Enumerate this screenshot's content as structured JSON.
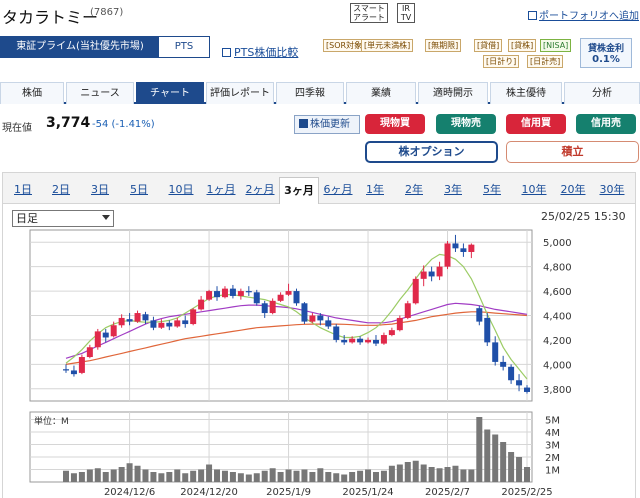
{
  "header": {
    "company": "タカラトミー",
    "code": "(7867)",
    "smart_alert": [
      "スマート",
      "アラート"
    ],
    "irtv": [
      "IR",
      "TV"
    ],
    "portfolio_link": "ポートフォリオへ追加"
  },
  "market_tabs": [
    "東証プライム(当社優先市場)",
    "PTS"
  ],
  "pts_compare": "PTS株価比較",
  "badges": [
    "[SOR対象]",
    "[単元未満株]",
    "[無期限]",
    "[貸借]",
    "[貸株]",
    "[NISA]",
    "[日計り]",
    "[日計売]"
  ],
  "margin_rate": {
    "title": "貸株金利",
    "value": "0.1%"
  },
  "main_tabs": [
    "株価",
    "ニュース",
    "チャート",
    "評価レポート",
    "四季報",
    "業績",
    "適時開示",
    "株主優待",
    "分析"
  ],
  "price": {
    "label": "現在値",
    "value": "3,774",
    "change": "-54 (-1.41%)"
  },
  "refresh": "株価更新",
  "trade_buttons": [
    "現物買",
    "現物売",
    "信用買",
    "信用売"
  ],
  "option_button": "株オプション",
  "tsumitate_button": "積立",
  "periods": [
    "1日",
    "2日",
    "3日",
    "5日",
    "10日",
    "1ヶ月",
    "2ヶ月",
    "3ヶ月",
    "6ヶ月",
    "1年",
    "2年",
    "3年",
    "5年",
    "10年",
    "20年",
    "30年"
  ],
  "active_period": "3ヶ月",
  "chart_select": "日足",
  "datetime": "25/02/25 15:30",
  "volume_unit": "単位：M",
  "colors": {
    "up": "#e0294a",
    "down": "#1f4fa8",
    "ma_short": "#9ccc65",
    "ma_mid": "#a13cc4",
    "ma_long": "#e0663a",
    "brand": "#1e4a8c"
  },
  "chart_data": {
    "type": "candlestick",
    "ylim": [
      3700,
      5100
    ],
    "yticks": [
      "5,000",
      "4,800",
      "4,600",
      "4,400",
      "4,200",
      "4,000",
      "3,800"
    ],
    "ytick_values": [
      5000,
      4800,
      4600,
      4400,
      4200,
      4000,
      3800
    ],
    "xticks": [
      "2024/12/6",
      "2024/12/20",
      "2025/1/9",
      "2025/1/24",
      "2025/2/7",
      "2025/2/25"
    ],
    "volume_ylim": [
      0,
      5.6
    ],
    "volume_yticks": [
      "5M",
      "4M",
      "3M",
      "2M",
      "1M"
    ],
    "volume_ytick_values": [
      5,
      4,
      3,
      2,
      1
    ],
    "candles": [
      {
        "date": "2024/11/26",
        "o": 3960,
        "h": 4000,
        "l": 3930,
        "c": 3950
      },
      {
        "date": "2024/11/27",
        "o": 3950,
        "h": 3990,
        "l": 3900,
        "c": 3920
      },
      {
        "date": "2024/11/28",
        "o": 3930,
        "h": 4080,
        "l": 3920,
        "c": 4060
      },
      {
        "date": "2024/11/29",
        "o": 4060,
        "h": 4160,
        "l": 4050,
        "c": 4140
      },
      {
        "date": "2024/12/2",
        "o": 4140,
        "h": 4290,
        "l": 4120,
        "c": 4270
      },
      {
        "date": "2024/12/3",
        "o": 4260,
        "h": 4290,
        "l": 4180,
        "c": 4220
      },
      {
        "date": "2024/12/4",
        "o": 4230,
        "h": 4350,
        "l": 4220,
        "c": 4320
      },
      {
        "date": "2024/12/5",
        "o": 4320,
        "h": 4410,
        "l": 4300,
        "c": 4380
      },
      {
        "date": "2024/12/6",
        "o": 4370,
        "h": 4420,
        "l": 4320,
        "c": 4350
      },
      {
        "date": "2024/12/9",
        "o": 4350,
        "h": 4440,
        "l": 4340,
        "c": 4420
      },
      {
        "date": "2024/12/10",
        "o": 4410,
        "h": 4430,
        "l": 4330,
        "c": 4360
      },
      {
        "date": "2024/12/11",
        "o": 4360,
        "h": 4390,
        "l": 4280,
        "c": 4300
      },
      {
        "date": "2024/12/12",
        "o": 4300,
        "h": 4370,
        "l": 4290,
        "c": 4340
      },
      {
        "date": "2024/12/13",
        "o": 4340,
        "h": 4360,
        "l": 4280,
        "c": 4310
      },
      {
        "date": "2024/12/16",
        "o": 4310,
        "h": 4380,
        "l": 4300,
        "c": 4360
      },
      {
        "date": "2024/12/17",
        "o": 4360,
        "h": 4400,
        "l": 4300,
        "c": 4330
      },
      {
        "date": "2024/12/18",
        "o": 4330,
        "h": 4460,
        "l": 4320,
        "c": 4450
      },
      {
        "date": "2024/12/19",
        "o": 4450,
        "h": 4560,
        "l": 4440,
        "c": 4530
      },
      {
        "date": "2024/12/20",
        "o": 4530,
        "h": 4610,
        "l": 4520,
        "c": 4600
      },
      {
        "date": "2024/12/23",
        "o": 4600,
        "h": 4640,
        "l": 4520,
        "c": 4550
      },
      {
        "date": "2024/12/24",
        "o": 4550,
        "h": 4640,
        "l": 4540,
        "c": 4620
      },
      {
        "date": "2024/12/25",
        "o": 4620,
        "h": 4650,
        "l": 4540,
        "c": 4560
      },
      {
        "date": "2024/12/26",
        "o": 4560,
        "h": 4620,
        "l": 4530,
        "c": 4600
      },
      {
        "date": "2024/12/27",
        "o": 4600,
        "h": 4640,
        "l": 4560,
        "c": 4590
      },
      {
        "date": "2024/12/30",
        "o": 4590,
        "h": 4610,
        "l": 4480,
        "c": 4500
      },
      {
        "date": "2025/1/6",
        "o": 4500,
        "h": 4520,
        "l": 4380,
        "c": 4420
      },
      {
        "date": "2025/1/7",
        "o": 4420,
        "h": 4540,
        "l": 4410,
        "c": 4520
      },
      {
        "date": "2025/1/8",
        "o": 4520,
        "h": 4590,
        "l": 4510,
        "c": 4570
      },
      {
        "date": "2025/1/9",
        "o": 4570,
        "h": 4660,
        "l": 4560,
        "c": 4600
      },
      {
        "date": "2025/1/10",
        "o": 4600,
        "h": 4620,
        "l": 4480,
        "c": 4500
      },
      {
        "date": "2025/1/14",
        "o": 4500,
        "h": 4510,
        "l": 4330,
        "c": 4350
      },
      {
        "date": "2025/1/15",
        "o": 4350,
        "h": 4420,
        "l": 4340,
        "c": 4400
      },
      {
        "date": "2025/1/16",
        "o": 4400,
        "h": 4420,
        "l": 4320,
        "c": 4360
      },
      {
        "date": "2025/1/17",
        "o": 4360,
        "h": 4390,
        "l": 4290,
        "c": 4310
      },
      {
        "date": "2025/1/20",
        "o": 4310,
        "h": 4330,
        "l": 4180,
        "c": 4200
      },
      {
        "date": "2025/1/21",
        "o": 4200,
        "h": 4240,
        "l": 4160,
        "c": 4180
      },
      {
        "date": "2025/1/22",
        "o": 4180,
        "h": 4230,
        "l": 4170,
        "c": 4210
      },
      {
        "date": "2025/1/23",
        "o": 4210,
        "h": 4230,
        "l": 4160,
        "c": 4180
      },
      {
        "date": "2025/1/24",
        "o": 4180,
        "h": 4220,
        "l": 4170,
        "c": 4200
      },
      {
        "date": "2025/1/27",
        "o": 4200,
        "h": 4240,
        "l": 4150,
        "c": 4170
      },
      {
        "date": "2025/1/28",
        "o": 4170,
        "h": 4260,
        "l": 4160,
        "c": 4240
      },
      {
        "date": "2025/1/29",
        "o": 4240,
        "h": 4300,
        "l": 4230,
        "c": 4280
      },
      {
        "date": "2025/1/30",
        "o": 4280,
        "h": 4400,
        "l": 4270,
        "c": 4380
      },
      {
        "date": "2025/1/31",
        "o": 4380,
        "h": 4520,
        "l": 4370,
        "c": 4500
      },
      {
        "date": "2025/2/3",
        "o": 4500,
        "h": 4720,
        "l": 4490,
        "c": 4700
      },
      {
        "date": "2025/2/4",
        "o": 4700,
        "h": 4810,
        "l": 4640,
        "c": 4760
      },
      {
        "date": "2025/2/5",
        "o": 4760,
        "h": 4800,
        "l": 4680,
        "c": 4720
      },
      {
        "date": "2025/2/6",
        "o": 4720,
        "h": 4840,
        "l": 4690,
        "c": 4800
      },
      {
        "date": "2025/2/7",
        "o": 4800,
        "h": 5010,
        "l": 4780,
        "c": 4990
      },
      {
        "date": "2025/2/10",
        "o": 4990,
        "h": 5060,
        "l": 4920,
        "c": 4950
      },
      {
        "date": "2025/2/12",
        "o": 4950,
        "h": 4990,
        "l": 4880,
        "c": 4920
      },
      {
        "date": "2025/2/13",
        "o": 4920,
        "h": 4990,
        "l": 4870,
        "c": 4980
      },
      {
        "date": "2025/2/14",
        "o": 4460,
        "h": 4480,
        "l": 4320,
        "c": 4350
      },
      {
        "date": "2025/2/17",
        "o": 4380,
        "h": 4420,
        "l": 4150,
        "c": 4180
      },
      {
        "date": "2025/2/18",
        "o": 4180,
        "h": 4230,
        "l": 3990,
        "c": 4020
      },
      {
        "date": "2025/2/19",
        "o": 4020,
        "h": 4070,
        "l": 3950,
        "c": 3980
      },
      {
        "date": "2025/2/20",
        "o": 3980,
        "h": 4000,
        "l": 3840,
        "c": 3870
      },
      {
        "date": "2025/2/21",
        "o": 3870,
        "h": 3920,
        "l": 3780,
        "c": 3828
      },
      {
        "date": "2025/2/25",
        "o": 3810,
        "h": 3830,
        "l": 3760,
        "c": 3774
      }
    ],
    "volume": [
      0.9,
      0.7,
      0.8,
      1.0,
      1.1,
      0.8,
      1.0,
      1.2,
      1.5,
      1.3,
      1.0,
      0.8,
      0.7,
      0.8,
      1.0,
      0.7,
      0.9,
      1.0,
      1.4,
      1.0,
      0.9,
      0.8,
      0.7,
      0.6,
      0.7,
      0.9,
      1.1,
      0.8,
      1.0,
      0.9,
      1.0,
      0.8,
      1.1,
      0.8,
      0.7,
      0.6,
      0.8,
      0.9,
      1.0,
      0.8,
      0.9,
      1.3,
      1.4,
      1.6,
      1.7,
      1.4,
      1.2,
      1.1,
      1.2,
      1.3,
      1.0,
      1.0,
      5.2,
      4.2,
      3.8,
      3.2,
      2.4,
      2.0,
      1.2
    ],
    "ma_short": [
      4010,
      4060,
      4120,
      4190,
      4250,
      4300,
      4330,
      4350,
      4360,
      4350,
      4345,
      4345,
      4350,
      4360,
      4380,
      4420,
      4460,
      4500,
      4540,
      4560,
      4570,
      4570,
      4560,
      4550,
      4540,
      4530,
      4510,
      4490,
      4470,
      4430,
      4380,
      4340,
      4300,
      4270,
      4240,
      4220,
      4220,
      4230,
      4260,
      4300,
      4360,
      4440,
      4530,
      4610,
      4700,
      4790,
      4860,
      4900,
      4890,
      4860,
      4800,
      4700,
      4560,
      4410,
      4280,
      4140,
      4040,
      3960,
      3880
    ],
    "ma_mid": [
      4050,
      4070,
      4090,
      4120,
      4150,
      4180,
      4210,
      4240,
      4270,
      4300,
      4330,
      4355,
      4375,
      4390,
      4400,
      4410,
      4420,
      4430,
      4440,
      4450,
      4460,
      4470,
      4480,
      4485,
      4485,
      4480,
      4475,
      4470,
      4465,
      4455,
      4440,
      4425,
      4410,
      4395,
      4380,
      4370,
      4360,
      4350,
      4340,
      4340,
      4340,
      4350,
      4370,
      4390,
      4410,
      4430,
      4450,
      4470,
      4490,
      4500,
      4495,
      4490,
      4480,
      4465,
      4450,
      4440,
      4430,
      4420,
      4410
    ],
    "ma_long": [
      4000,
      4010,
      4020,
      4030,
      4045,
      4060,
      4075,
      4090,
      4105,
      4120,
      4135,
      4150,
      4165,
      4180,
      4195,
      4210,
      4220,
      4230,
      4240,
      4250,
      4260,
      4270,
      4280,
      4290,
      4300,
      4305,
      4310,
      4315,
      4320,
      4325,
      4328,
      4330,
      4330,
      4330,
      4330,
      4328,
      4325,
      4320,
      4320,
      4320,
      4325,
      4330,
      4340,
      4350,
      4360,
      4375,
      4390,
      4400,
      4410,
      4420,
      4425,
      4430,
      4430,
      4425,
      4420,
      4415,
      4410,
      4405,
      4400
    ]
  }
}
